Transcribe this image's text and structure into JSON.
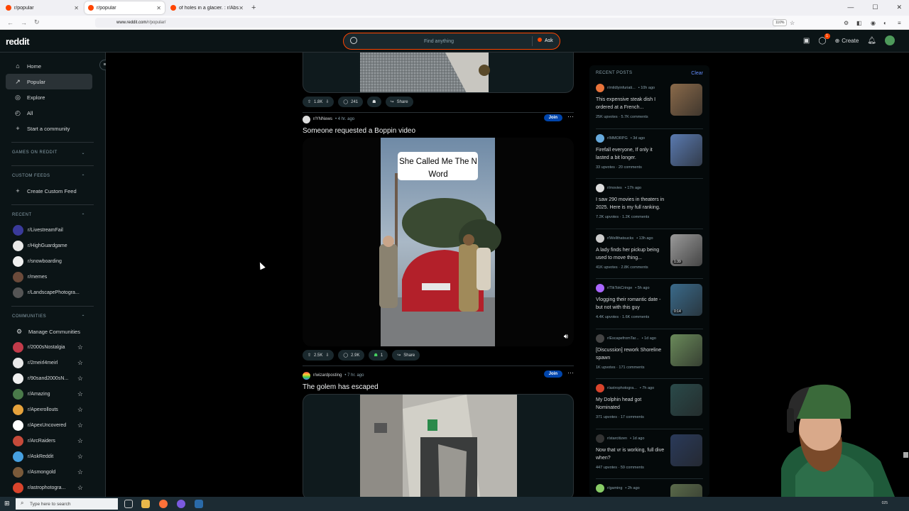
{
  "browser": {
    "tabs": [
      {
        "title": "r/popular",
        "active": false
      },
      {
        "title": "r/popular",
        "active": true
      },
      {
        "title": "of holes in a glacier. : r/Absolut",
        "active": false
      }
    ],
    "url_host": "www.reddit.com",
    "url_path": "/r/popular/",
    "zoom": "110%"
  },
  "header": {
    "logo": "reddit",
    "search_placeholder": "Find anything",
    "ask_label": "Ask",
    "create_label": "Create",
    "chat_badge": "1"
  },
  "sidebar": {
    "nav": [
      {
        "label": "Home",
        "icon": "home-icon",
        "glyph": "⌂"
      },
      {
        "label": "Popular",
        "icon": "popular-icon",
        "glyph": "↗"
      },
      {
        "label": "Explore",
        "icon": "explore-icon",
        "glyph": "◎"
      },
      {
        "label": "All",
        "icon": "all-icon",
        "glyph": "◴"
      },
      {
        "label": "Start a community",
        "icon": "plus-icon",
        "glyph": "+"
      }
    ],
    "games_label": "GAMES ON REDDIT",
    "custom_feeds_label": "CUSTOM FEEDS",
    "create_feed_label": "Create Custom Feed",
    "recent_label": "RECENT",
    "recent": [
      {
        "name": "r/LivestreamFail",
        "color": "#3a3a9a"
      },
      {
        "name": "r/HighGuardgame",
        "color": "#e8e8e8"
      },
      {
        "name": "r/snowboarding",
        "color": "#f0f0f0"
      },
      {
        "name": "r/memes",
        "color": "#6b4a3a"
      },
      {
        "name": "r/LandscapePhotogra...",
        "color": "#555555"
      }
    ],
    "communities_label": "COMMUNITIES",
    "manage_label": "Manage Communities",
    "communities": [
      {
        "name": "r/2000sNostalgia",
        "color": "#c23b4a"
      },
      {
        "name": "r/2meirl4meirl",
        "color": "#e9e9e9"
      },
      {
        "name": "r/90sand2000sN...",
        "color": "#f0f0f0"
      },
      {
        "name": "r/Amazing",
        "color": "#4a7a4a"
      },
      {
        "name": "r/Apexrollouts",
        "color": "#e6a23c"
      },
      {
        "name": "r/ApexUncovered",
        "color": "#ffffff"
      },
      {
        "name": "r/ArcRaiders",
        "color": "#c54a3a"
      },
      {
        "name": "r/AskReddit",
        "color": "#46a0e0"
      },
      {
        "name": "r/Asmongold",
        "color": "#7a5a3a"
      },
      {
        "name": "r/astrophotogra...",
        "color": "#d9442c"
      }
    ]
  },
  "feed": {
    "post1": {
      "upvotes": "1.8K",
      "comments": "241",
      "share": "Share"
    },
    "post2": {
      "subreddit": "r/YNNews",
      "time": "• 4 hr. ago",
      "join": "Join",
      "title": "Someone requested a Boppin video",
      "caption": "She Called Me The N Word",
      "upvotes": "2.5K",
      "comments": "2.9K",
      "awards": "1",
      "share": "Share"
    },
    "post3": {
      "subreddit": "r/wizardposting",
      "time": "• 7 hr. ago",
      "join": "Join",
      "title": "The golem has escaped"
    }
  },
  "recent_posts": {
    "header": "RECENT POSTS",
    "clear": "Clear",
    "items": [
      {
        "sub": "r/mildlyinfuriati...",
        "time": "• 10h ago",
        "title": "This expensive steak dish I ordered at a French...",
        "upvotes": "25K upvotes",
        "comments": "5.7K comments",
        "icon_color": "#e8743b",
        "thumb": "#8a6a4a",
        "video": ""
      },
      {
        "sub": "r/MMORPG",
        "time": "• 3d ago",
        "title": "Firefall everyone, If only it lasted a bit longer.",
        "upvotes": "33 upvotes",
        "comments": "20 comments",
        "icon_color": "#6ad",
        "thumb": "#5a7ab0",
        "video": ""
      },
      {
        "sub": "r/movies",
        "time": "• 17h ago",
        "title": "I saw 290 movies in theaters in 2025. Here is my full ranking.",
        "upvotes": "7.2K upvotes",
        "comments": "1.2K comments",
        "icon_color": "#ddd",
        "thumb": "",
        "video": ""
      },
      {
        "sub": "r/Wellthatsucks",
        "time": "• 13h ago",
        "title": "A lady finds her pickup being used to move thing...",
        "upvotes": "41K upvotes",
        "comments": "2.8K comments",
        "icon_color": "#ccc",
        "thumb": "#9a9a9a",
        "video": "1:39"
      },
      {
        "sub": "r/TikTokCringe",
        "time": "• 5h ago",
        "title": "Vlogging their romantic date -but not with this guy",
        "upvotes": "4.4K upvotes",
        "comments": "1.6K comments",
        "icon_color": "#a6f",
        "thumb": "#3a6a8a",
        "video": "0:14"
      },
      {
        "sub": "r/EscapefromTar...",
        "time": "• 1d ago",
        "title": "[Discussion] rework Shoreline spawn",
        "upvotes": "1K upvotes",
        "comments": "171 comments",
        "icon_color": "#444",
        "thumb": "#6a8a5a",
        "video": ""
      },
      {
        "sub": "r/astrophotogra...",
        "time": "• 7h ago",
        "title": "My Dolphin head got Nominated",
        "upvotes": "371 upvotes",
        "comments": "17 comments",
        "icon_color": "#d9442c",
        "thumb": "#2a4a4a",
        "video": ""
      },
      {
        "sub": "r/starcitizen",
        "time": "• 1d ago",
        "title": "Now that vr is working, full dive when?",
        "upvotes": "447 upvotes",
        "comments": "59 comments",
        "icon_color": "#333",
        "thumb": "#2a3a5a",
        "video": ""
      },
      {
        "sub": "r/gaming",
        "time": "• 2h ago",
        "title": "",
        "upvotes": "",
        "comments": "",
        "icon_color": "#8c6",
        "thumb": "#5a6a4a",
        "video": ""
      }
    ]
  },
  "taskbar": {
    "search_placeholder": "Type here to search",
    "clock": "025"
  }
}
